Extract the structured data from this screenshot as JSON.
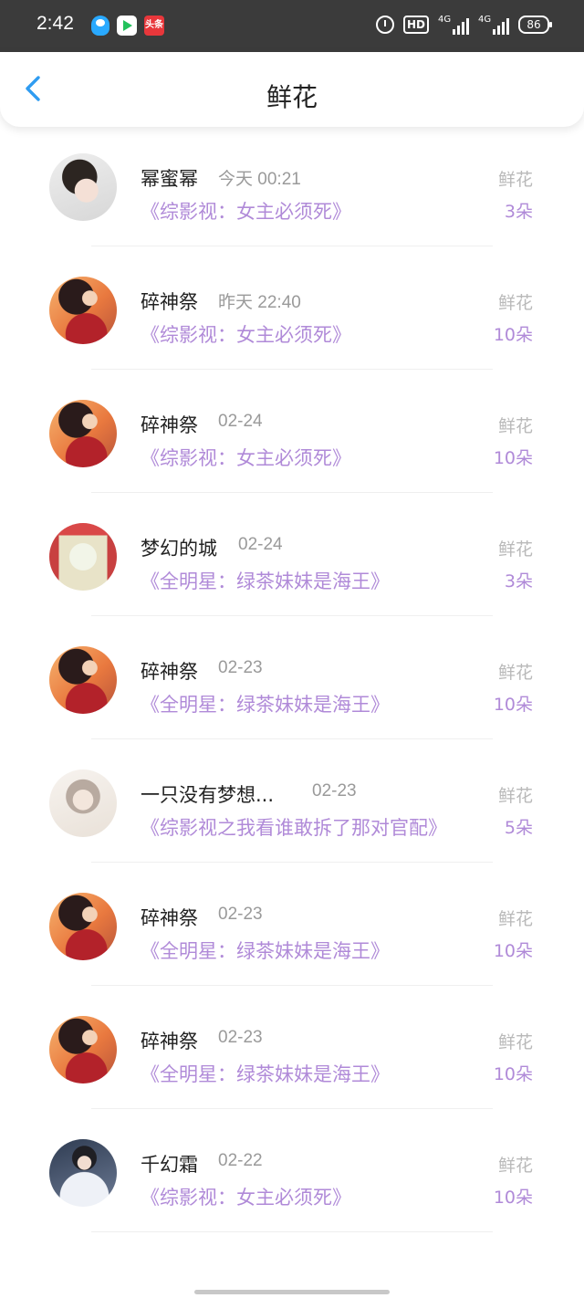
{
  "status_bar": {
    "time": "2:42",
    "app_icons": [
      "qq-icon",
      "tencent-video-icon",
      "toutiao-icon"
    ],
    "news_app_label": "头条",
    "hd_label": "HD",
    "network_1": "4G",
    "network_2": "4G",
    "battery": "86"
  },
  "header": {
    "title": "鲜花",
    "back_icon": "chevron-left-icon",
    "accent_color": "#2f9cf1"
  },
  "list": {
    "type_color": "#b9b9b9",
    "book_color": "#b08ad8",
    "items": [
      {
        "name": "",
        "time": "",
        "book": "",
        "type": "",
        "count": "",
        "avatar": "partial"
      },
      {
        "name": "幂蜜幂",
        "time": "今天 00:21",
        "book": "《综影视：女主必须死》",
        "type": "鲜花",
        "count": "3朵",
        "avatar": "girl"
      },
      {
        "name": "碎神祭",
        "time": "昨天 22:40",
        "book": "《综影视：女主必须死》",
        "type": "鲜花",
        "count": "10朵",
        "avatar": "red"
      },
      {
        "name": "碎神祭",
        "time": "02-24",
        "book": "《综影视：女主必须死》",
        "type": "鲜花",
        "count": "10朵",
        "avatar": "red"
      },
      {
        "name": "梦幻的城",
        "time": "02-24",
        "book": "《全明星：绿茶妹妹是海王》",
        "type": "鲜花",
        "count": "3朵",
        "avatar": "gate"
      },
      {
        "name": "碎神祭",
        "time": "02-23",
        "book": "《全明星：绿茶妹妹是海王》",
        "type": "鲜花",
        "count": "10朵",
        "avatar": "red"
      },
      {
        "name": "一只没有梦想...",
        "time": "02-23",
        "book": "《综影视之我看谁敢拆了那对官配》",
        "type": "鲜花",
        "count": "5朵",
        "avatar": "anime"
      },
      {
        "name": "碎神祭",
        "time": "02-23",
        "book": "《全明星：绿茶妹妹是海王》",
        "type": "鲜花",
        "count": "10朵",
        "avatar": "red"
      },
      {
        "name": "碎神祭",
        "time": "02-23",
        "book": "《全明星：绿茶妹妹是海王》",
        "type": "鲜花",
        "count": "10朵",
        "avatar": "red"
      },
      {
        "name": "千幻霜",
        "time": "02-22",
        "book": "《综影视：女主必须死》",
        "type": "鲜花",
        "count": "10朵",
        "avatar": "white"
      }
    ]
  }
}
